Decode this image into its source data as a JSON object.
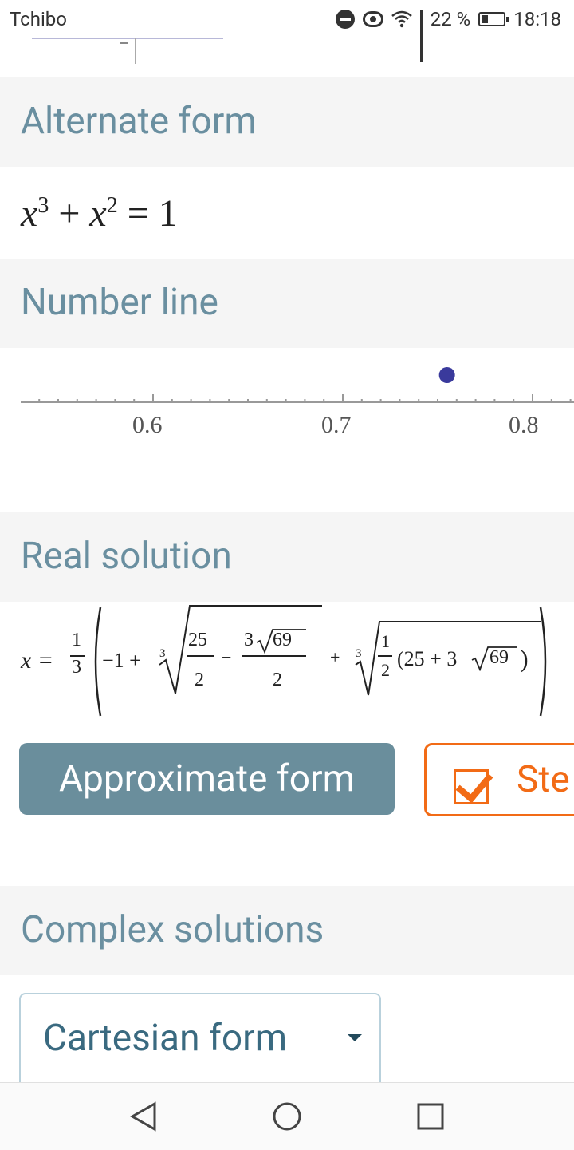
{
  "status_bar": {
    "carrier": "Tchibo",
    "battery_percent": "22 %",
    "time": "18:18"
  },
  "sections": {
    "alternate_form": {
      "title": "Alternate form",
      "base": "x",
      "exp1": "3",
      "plus": "+",
      "exp2": "2",
      "equals": "=",
      "rhs": "1"
    },
    "number_line": {
      "title": "Number line",
      "ticks": [
        "0.6",
        "0.7",
        "0.8"
      ],
      "point_value": 0.7549
    },
    "real_solution": {
      "title": "Real solution",
      "lhs": "x =",
      "one": "1",
      "three": "3",
      "minus_one_plus": "−1 +",
      "cube_index": "3",
      "twentyfive": "25",
      "two": "2",
      "minus": "−",
      "three_sqrt": "3",
      "sixtynine": "69",
      "plus": "+",
      "half_num": "1",
      "half_den": "2",
      "inner": "(25 + 3",
      "inner_close": ")"
    },
    "buttons": {
      "approximate": "Approximate form",
      "steps": "Ste"
    },
    "complex_solutions": {
      "title": "Complex solutions",
      "dropdown_value": "Cartesian form"
    }
  },
  "nav": {
    "back": "back-icon",
    "home": "home-icon",
    "recents": "recents-icon"
  }
}
